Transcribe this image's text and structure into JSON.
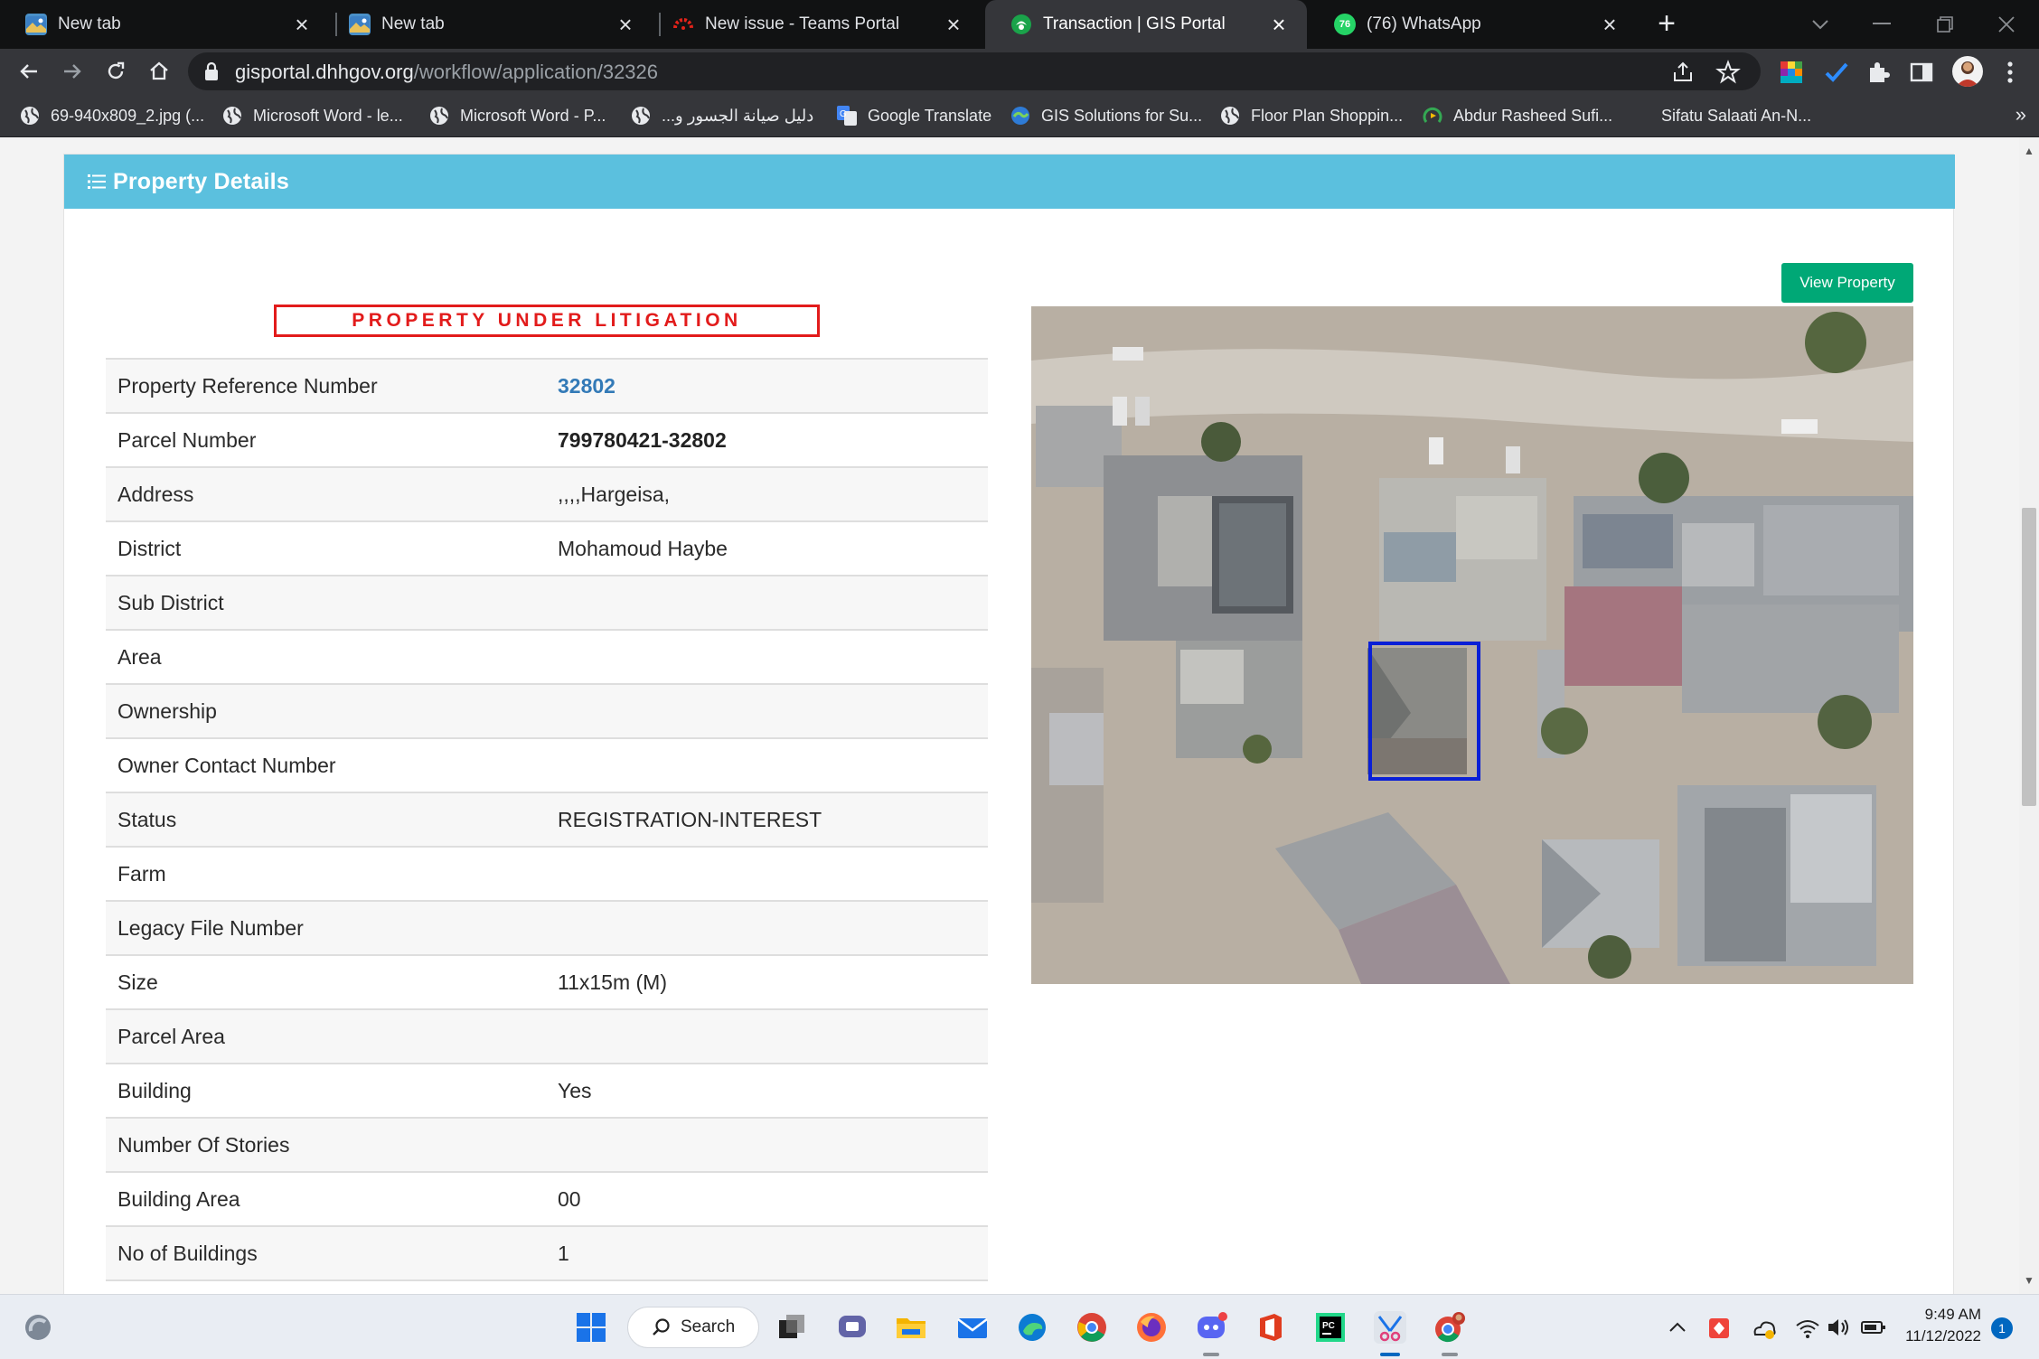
{
  "tabs": [
    {
      "title": "New tab",
      "favicon": "new-tab-icon",
      "active": false
    },
    {
      "title": "New tab",
      "favicon": "new-tab-icon",
      "active": false
    },
    {
      "title": "New issue - Teams Portal",
      "favicon": "teams-portal-icon",
      "active": false
    },
    {
      "title": "Transaction | GIS Portal",
      "favicon": "gis-portal-icon",
      "active": true
    },
    {
      "title": "(76) WhatsApp",
      "favicon": "whatsapp-icon",
      "active": false
    }
  ],
  "whatsapp_badge": "76",
  "address": {
    "host": "gisportal.dhhgov.org",
    "path": "/workflow/application/32326"
  },
  "bookmarks": [
    {
      "label": "69-940x809_2.jpg (...",
      "icon": "globe-icon"
    },
    {
      "label": "Microsoft Word - le...",
      "icon": "globe-icon"
    },
    {
      "label": "Microsoft Word - P...",
      "icon": "globe-icon"
    },
    {
      "label": "دليل صيانة الجسور و...",
      "icon": "globe-icon"
    },
    {
      "label": "Google Translate",
      "icon": "google-translate-icon"
    },
    {
      "label": "GIS Solutions for Su...",
      "icon": "gis-solutions-icon"
    },
    {
      "label": "Floor Plan Shoppin...",
      "icon": "globe-icon"
    },
    {
      "label": "Abdur Rasheed Sufi...",
      "icon": "podcast-icon"
    },
    {
      "label": "Sifatu Salaati An-N...",
      "icon": "none"
    }
  ],
  "panel": {
    "title": "Property Details",
    "litigation_notice": "PROPERTY UNDER LITIGATION",
    "view_button": "View Property"
  },
  "details": [
    {
      "label": "Property Reference Number",
      "value": "32802",
      "style": "link"
    },
    {
      "label": "Parcel Number",
      "value": "799780421-32802",
      "style": "bold"
    },
    {
      "label": "Address",
      "value": ",,,,Hargeisa,",
      "style": "plain"
    },
    {
      "label": "District",
      "value": "Mohamoud Haybe",
      "style": "plain"
    },
    {
      "label": "Sub District",
      "value": "",
      "style": "plain"
    },
    {
      "label": "Area",
      "value": "",
      "style": "plain"
    },
    {
      "label": "Ownership",
      "value": "",
      "style": "plain"
    },
    {
      "label": "Owner Contact Number",
      "value": "",
      "style": "plain"
    },
    {
      "label": "Status",
      "value": "REGISTRATION-INTEREST",
      "style": "plain"
    },
    {
      "label": "Farm",
      "value": "",
      "style": "plain"
    },
    {
      "label": "Legacy File Number",
      "value": "",
      "style": "plain"
    },
    {
      "label": "Size",
      "value": "11x15m (M)",
      "style": "plain"
    },
    {
      "label": "Parcel Area",
      "value": "",
      "style": "plain"
    },
    {
      "label": "Building",
      "value": "Yes",
      "style": "plain"
    },
    {
      "label": "Number Of Stories",
      "value": "",
      "style": "plain"
    },
    {
      "label": "Building Area",
      "value": "00",
      "style": "plain"
    },
    {
      "label": "No of Buildings",
      "value": "1",
      "style": "plain"
    }
  ],
  "taskbar": {
    "search_label": "Search",
    "time": "9:49 AM",
    "date": "11/12/2022",
    "notification_count": "1"
  },
  "colors": {
    "panel_header": "#5bc0de",
    "litigation_red": "#e21b1b",
    "view_button": "#00a876",
    "parcel_outline": "#0a1fd6",
    "link": "#337ab7"
  }
}
